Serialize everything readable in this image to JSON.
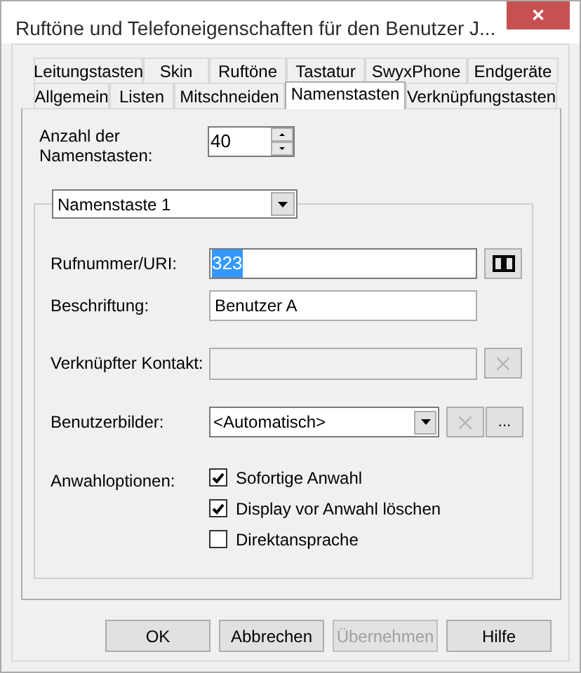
{
  "window": {
    "title": "Ruftöne und Telefoneigenschaften für den Benutzer J...",
    "close": "✕"
  },
  "tab_rows": [
    [
      {
        "label": "Leitungstasten",
        "selected": false
      },
      {
        "label": "Skin",
        "selected": false
      },
      {
        "label": "Ruftöne",
        "selected": false
      },
      {
        "label": "Tastatur",
        "selected": false
      },
      {
        "label": "SwyxPhone",
        "selected": false
      },
      {
        "label": "Endgeräte",
        "selected": false
      }
    ],
    [
      {
        "label": "Allgemein",
        "selected": false
      },
      {
        "label": "Listen",
        "selected": false
      },
      {
        "label": "Mitschneiden",
        "selected": false
      },
      {
        "label": "Namenstasten",
        "selected": true
      },
      {
        "label": "Verknüpfungstasten",
        "selected": false
      }
    ]
  ],
  "count": {
    "label": "Anzahl der Namenstasten:",
    "value": "40"
  },
  "group": {
    "selector": "Namenstaste 1"
  },
  "rows": [
    {
      "kind": "number",
      "label": "Rufnummer/URI:",
      "value": "323",
      "selected_text": true
    },
    {
      "kind": "text",
      "label": "Beschriftung:",
      "value": "Benutzer A"
    },
    {
      "kind": "contact",
      "label": "Verknüpfter Kontakt:",
      "disabled": true
    },
    {
      "kind": "image",
      "label": "Benutzerbilder:",
      "value": "<Automatisch>",
      "more": "..."
    },
    {
      "kind": "options",
      "label": "Anwahloptionen:",
      "options": [
        {
          "label": "Sofortige Anwahl",
          "checked": true
        },
        {
          "label": "Display vor Anwahl löschen",
          "checked": true
        },
        {
          "label": "Direktansprache",
          "checked": false
        }
      ]
    }
  ],
  "buttons": [
    {
      "label": "OK",
      "disabled": false
    },
    {
      "label": "Abbrechen",
      "disabled": false
    },
    {
      "label": "Übernehmen",
      "disabled": true
    },
    {
      "label": "Hilfe",
      "disabled": false
    }
  ]
}
